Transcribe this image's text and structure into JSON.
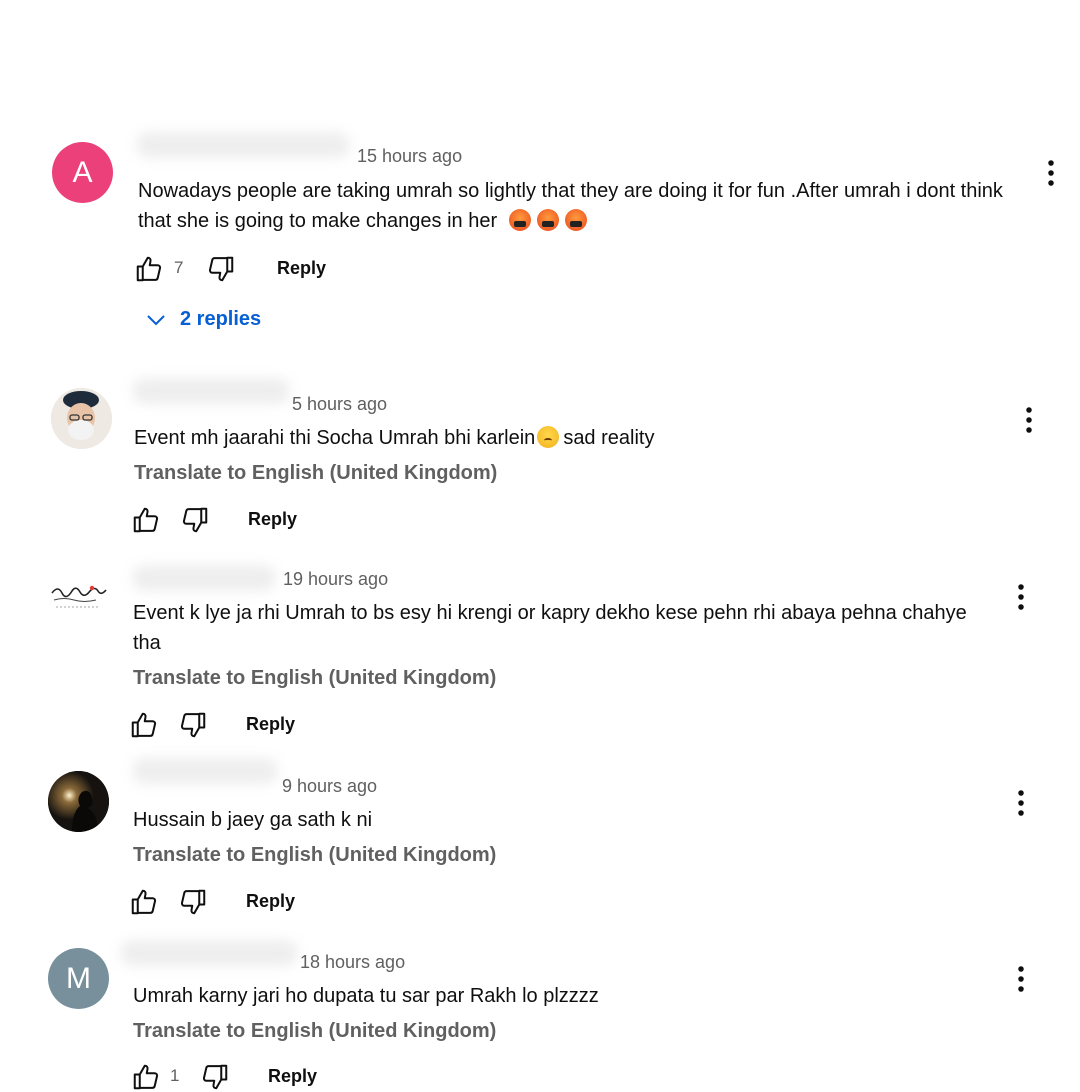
{
  "colors": {
    "link_blue": "#065fd4",
    "avatar_a": "#ec407a",
    "avatar_m": "#78909c",
    "muted_text": "#606060"
  },
  "comments": [
    {
      "avatar_letter": "A",
      "time": "15 hours ago",
      "text": "Nowadays people are taking umrah so lightly that they are doing it for fun .After umrah i dont think that she is going to make changes in her",
      "likes": "7",
      "reply_label": "Reply",
      "replies_label": "2 replies"
    },
    {
      "time": "5 hours ago",
      "text": "Event mh jaarahi thi Socha Umrah bhi karlein",
      "text_after": "sad reality",
      "translate_label": "Translate to English (United Kingdom)",
      "reply_label": "Reply"
    },
    {
      "time": "19 hours ago",
      "text": "Event k lye ja rhi Umrah to bs esy hi krengi or kapry dekho kese pehn rhi abaya pehna chahye tha",
      "translate_label": "Translate to English (United Kingdom)",
      "reply_label": "Reply"
    },
    {
      "time": "9 hours ago",
      "text": "Hussain b jaey ga sath k ni",
      "translate_label": "Translate to English (United Kingdom)",
      "reply_label": "Reply"
    },
    {
      "avatar_letter": "M",
      "time": "18 hours ago",
      "text": "Umrah karny jari ho dupata tu sar par Rakh lo plzzzz",
      "translate_label": "Translate to English (United Kingdom)",
      "likes": "1",
      "reply_label": "Reply"
    }
  ]
}
